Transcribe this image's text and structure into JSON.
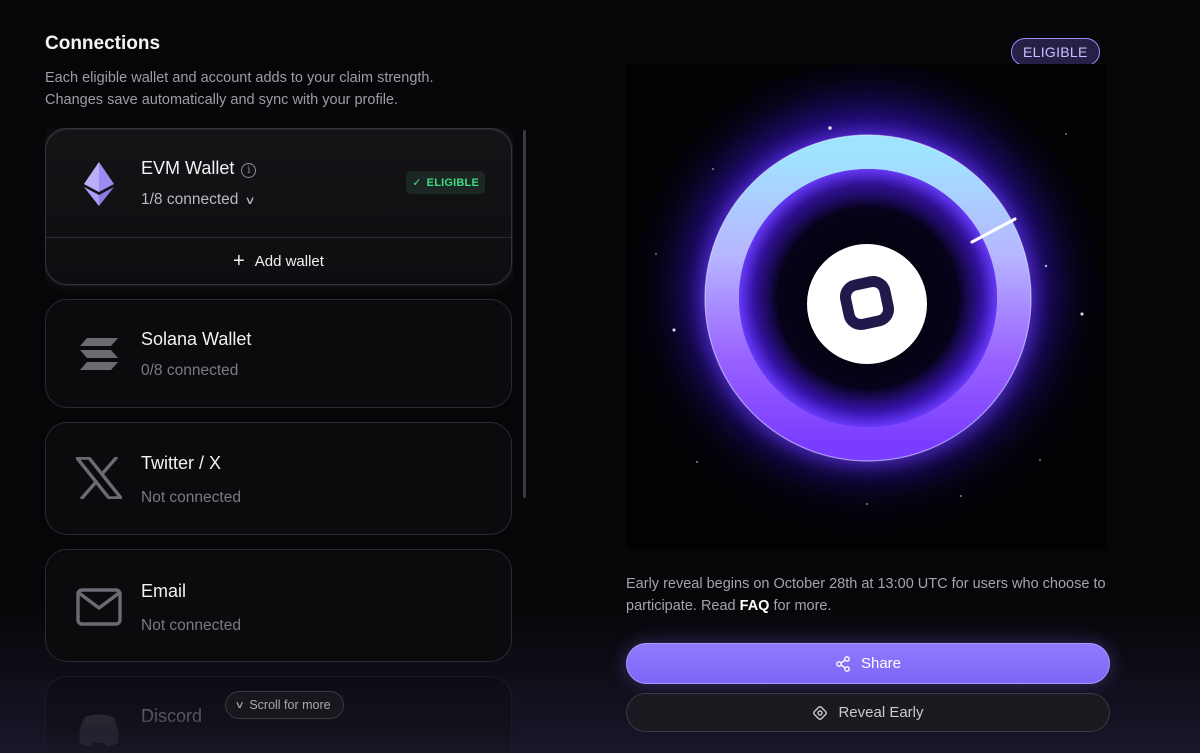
{
  "connections": {
    "title": "Connections",
    "subtitle_line1": "Each eligible wallet and account adds to your claim strength.",
    "subtitle_line2": "Changes save automatically and sync with your profile.",
    "cards": [
      {
        "name": "EVM Wallet",
        "status": "1/8 connected",
        "badge": "ELIGIBLE",
        "add_label": "Add wallet",
        "icon": "ethereum-icon"
      },
      {
        "name": "Solana Wallet",
        "status": "0/8 connected",
        "icon": "solana-icon"
      },
      {
        "name": "Twitter / X",
        "status": "Not connected",
        "icon": "x-logo-icon"
      },
      {
        "name": "Email",
        "status": "Not connected",
        "icon": "mail-icon"
      },
      {
        "name": "Discord",
        "status": "",
        "icon": "discord-icon"
      }
    ],
    "scroll_hint": "Scroll for more"
  },
  "eligibility": {
    "badge": "ELIGIBLE",
    "reveal_text_before": "Early reveal begins on October 28th at 13:00 UTC for users who choose to participate. Read ",
    "reveal_link": "FAQ",
    "reveal_text_after": " for more.",
    "share_label": "Share",
    "reveal_label": "Reveal Early"
  },
  "colors": {
    "accent": "#7b66f5",
    "eligible_green": "#3ddc84",
    "ring_glow": "#6a2cff"
  }
}
